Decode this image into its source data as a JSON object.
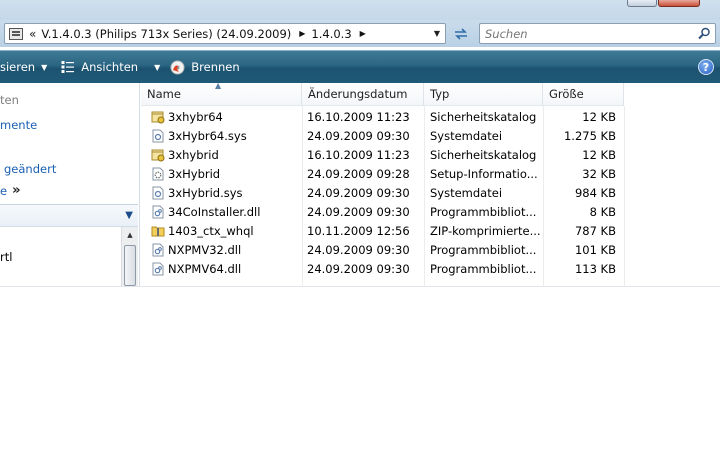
{
  "address": {
    "back_symbol": "«",
    "crumbs": [
      "V.1.4.0.3  (Philips 713x Series) (24.09.2009)",
      "1.4.0.3"
    ],
    "search_placeholder": "Suchen"
  },
  "toolbar": {
    "organize": "sieren",
    "views": "Ansichten",
    "burn": "Brennen"
  },
  "nav": {
    "items": [
      "ten",
      "mente",
      "geändert",
      "e"
    ],
    "more_symbol": "»",
    "folder_item": "rtl"
  },
  "columns": {
    "name": "Name",
    "date": "Änderungsdatum",
    "type": "Typ",
    "size": "Größe"
  },
  "files": [
    {
      "name": "3xhybr64",
      "date": "16.10.2009 11:23",
      "type": "Sicherheitskatalog",
      "size": "12 KB",
      "icon": "catalog-icon"
    },
    {
      "name": "3xHybr64.sys",
      "date": "24.09.2009 09:30",
      "type": "Systemdatei",
      "size": "1.275 KB",
      "icon": "system-file-icon"
    },
    {
      "name": "3xhybrid",
      "date": "16.10.2009 11:23",
      "type": "Sicherheitskatalog",
      "size": "12 KB",
      "icon": "catalog-icon"
    },
    {
      "name": "3xHybrid",
      "date": "24.09.2009 09:28",
      "type": "Setup-Informatio...",
      "size": "32 KB",
      "icon": "setup-info-icon"
    },
    {
      "name": "3xHybrid.sys",
      "date": "24.09.2009 09:30",
      "type": "Systemdatei",
      "size": "984 KB",
      "icon": "system-file-icon"
    },
    {
      "name": "34CoInstaller.dll",
      "date": "24.09.2009 09:30",
      "type": "Programmbibliot...",
      "size": "8 KB",
      "icon": "dll-icon"
    },
    {
      "name": "1403_ctx_whql",
      "date": "10.11.2009 12:56",
      "type": "ZIP-komprimierte...",
      "size": "787 KB",
      "icon": "zip-folder-icon"
    },
    {
      "name": "NXPMV32.dll",
      "date": "24.09.2009 09:30",
      "type": "Programmbibliot...",
      "size": "101 KB",
      "icon": "dll-icon"
    },
    {
      "name": "NXPMV64.dll",
      "date": "24.09.2009 09:30",
      "type": "Programmbibliot...",
      "size": "113 KB",
      "icon": "dll-icon"
    }
  ],
  "help_symbol": "?",
  "colors": {
    "toolbar": "#2a6582",
    "link": "#1a5fb4",
    "address_bar": "#c9dcec"
  }
}
